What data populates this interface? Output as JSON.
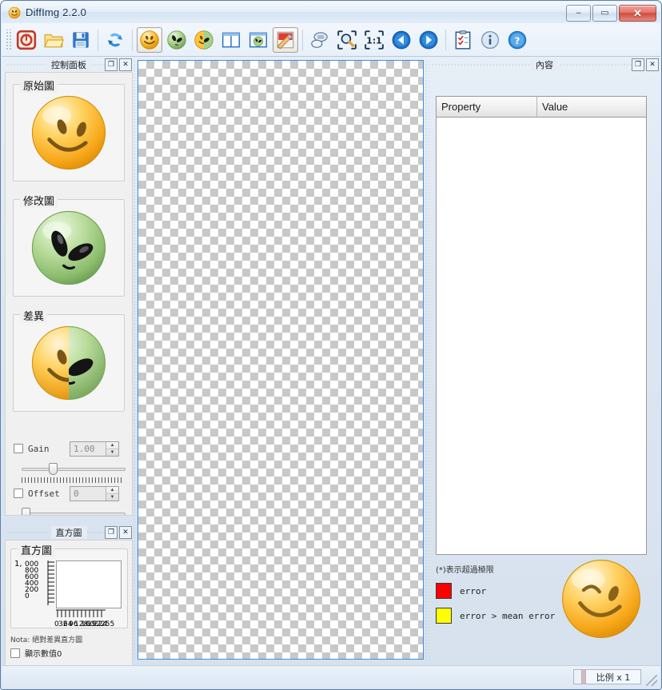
{
  "window": {
    "title": "DiffImg 2.2.0",
    "icon": "app-smiley-icon",
    "minimize_label": "–",
    "maximize_label": "▭",
    "close_label": "✕"
  },
  "toolbar": {
    "items": [
      {
        "name": "quit-button",
        "icon": "power-off-icon",
        "label": "Quit",
        "active": false
      },
      {
        "name": "open-button",
        "icon": "folder-open-icon",
        "label": "Open",
        "active": false
      },
      {
        "name": "save-button",
        "icon": "floppy-save-icon",
        "label": "Save",
        "active": false
      },
      {
        "name": "reload-button",
        "icon": "refresh-arrows-icon",
        "label": "Reload",
        "active": false
      },
      {
        "name": "original-image-button",
        "icon": "smiley-yellow-icon",
        "label": "Original image",
        "active": true
      },
      {
        "name": "modified-image-button",
        "icon": "alien-green-icon",
        "label": "Modified image",
        "active": false
      },
      {
        "name": "difference-image-button",
        "icon": "half-smiley-alien-icon",
        "label": "Difference image",
        "active": false
      },
      {
        "name": "split-view-button",
        "icon": "split-panes-icon",
        "label": "Split view",
        "active": false
      },
      {
        "name": "blend-view-button",
        "icon": "blend-image-icon",
        "label": "Blend view",
        "active": false
      },
      {
        "name": "mask-view-button",
        "icon": "mask-brush-icon",
        "label": "Mask view",
        "active": true
      },
      {
        "name": "comments-button",
        "icon": "speech-bubbles-icon",
        "label": "Comments",
        "active": false
      },
      {
        "name": "zoom-fit-button",
        "icon": "magnifier-fit-icon",
        "label": "Fit to window",
        "active": false
      },
      {
        "name": "zoom-actual-button",
        "icon": "one-to-one-icon",
        "label": "Actual size 1:1",
        "active": false
      },
      {
        "name": "previous-button",
        "icon": "arrow-left-circle-icon",
        "label": "Previous",
        "active": false
      },
      {
        "name": "next-button",
        "icon": "arrow-right-circle-icon",
        "label": "Next",
        "active": false
      },
      {
        "name": "checklist-button",
        "icon": "checklist-clipboard-icon",
        "label": "Check list",
        "active": false
      },
      {
        "name": "info-button",
        "icon": "info-circle-icon",
        "label": "Information",
        "active": false
      },
      {
        "name": "help-button",
        "icon": "question-circle-icon",
        "label": "Help",
        "active": false
      }
    ]
  },
  "control_panel": {
    "title": "控制面板",
    "float_btn": "❐",
    "close_btn": "✕",
    "groups": {
      "original": {
        "label": "原始圖",
        "icon": "smiley-yellow-icon"
      },
      "modified": {
        "label": "修改圖",
        "icon": "alien-green-icon"
      },
      "difference": {
        "label": "差異",
        "icon": "half-smiley-alien-icon"
      }
    },
    "gain": {
      "label": "Gain",
      "value": "1.00",
      "checked": false,
      "slider_percent": 28
    },
    "offset": {
      "label": "Offset",
      "value": "0",
      "checked": false,
      "slider_percent": 2
    }
  },
  "histogram_panel": {
    "title": "直方圖",
    "float_btn": "❐",
    "close_btn": "✕",
    "group_label": "直方圖",
    "note": "Nota: 絕對差異直方圖",
    "show_zero_label": "顯示數值0",
    "show_zero_checked": false
  },
  "chart_data": {
    "type": "bar",
    "title": "直方圖",
    "xlabel": "",
    "ylabel": "",
    "grid": false,
    "legend": "none",
    "categories": [
      "0",
      "32",
      "64",
      "96",
      "128",
      "160",
      "192",
      "224",
      "255"
    ],
    "values": [
      0,
      0,
      0,
      0,
      0,
      0,
      0,
      0,
      0
    ],
    "ylim": [
      0,
      1000
    ],
    "xlim": [
      0,
      255
    ],
    "ytick_labels": [
      "1,000",
      "800",
      "600",
      "400",
      "200",
      "0"
    ],
    "xtick_labels": [
      "0",
      "32",
      "64",
      "96",
      "128",
      "160",
      "192",
      "224",
      "255"
    ]
  },
  "canvas": {
    "name": "image-canvas",
    "background": "transparent-checkerboard",
    "border_color": "#3f8fdf"
  },
  "content_panel": {
    "title": "內容",
    "float_btn": "❐",
    "close_btn": "✕",
    "table": {
      "columns": [
        "Property",
        "Value"
      ],
      "rows": []
    },
    "legend": {
      "note": "(*)表示超過極限",
      "items": [
        {
          "color": "#ff0000",
          "label": "error"
        },
        {
          "color": "#ffff00",
          "label": "error > mean error"
        }
      ]
    },
    "mascot_icon": "winking-smiley-icon"
  },
  "status_bar": {
    "zoom_label": "比例 x 1"
  },
  "colors": {
    "accent": "#3f8fdf",
    "error": "#ff0000",
    "warn": "#ffff00",
    "frame": "#5a7fa8"
  }
}
